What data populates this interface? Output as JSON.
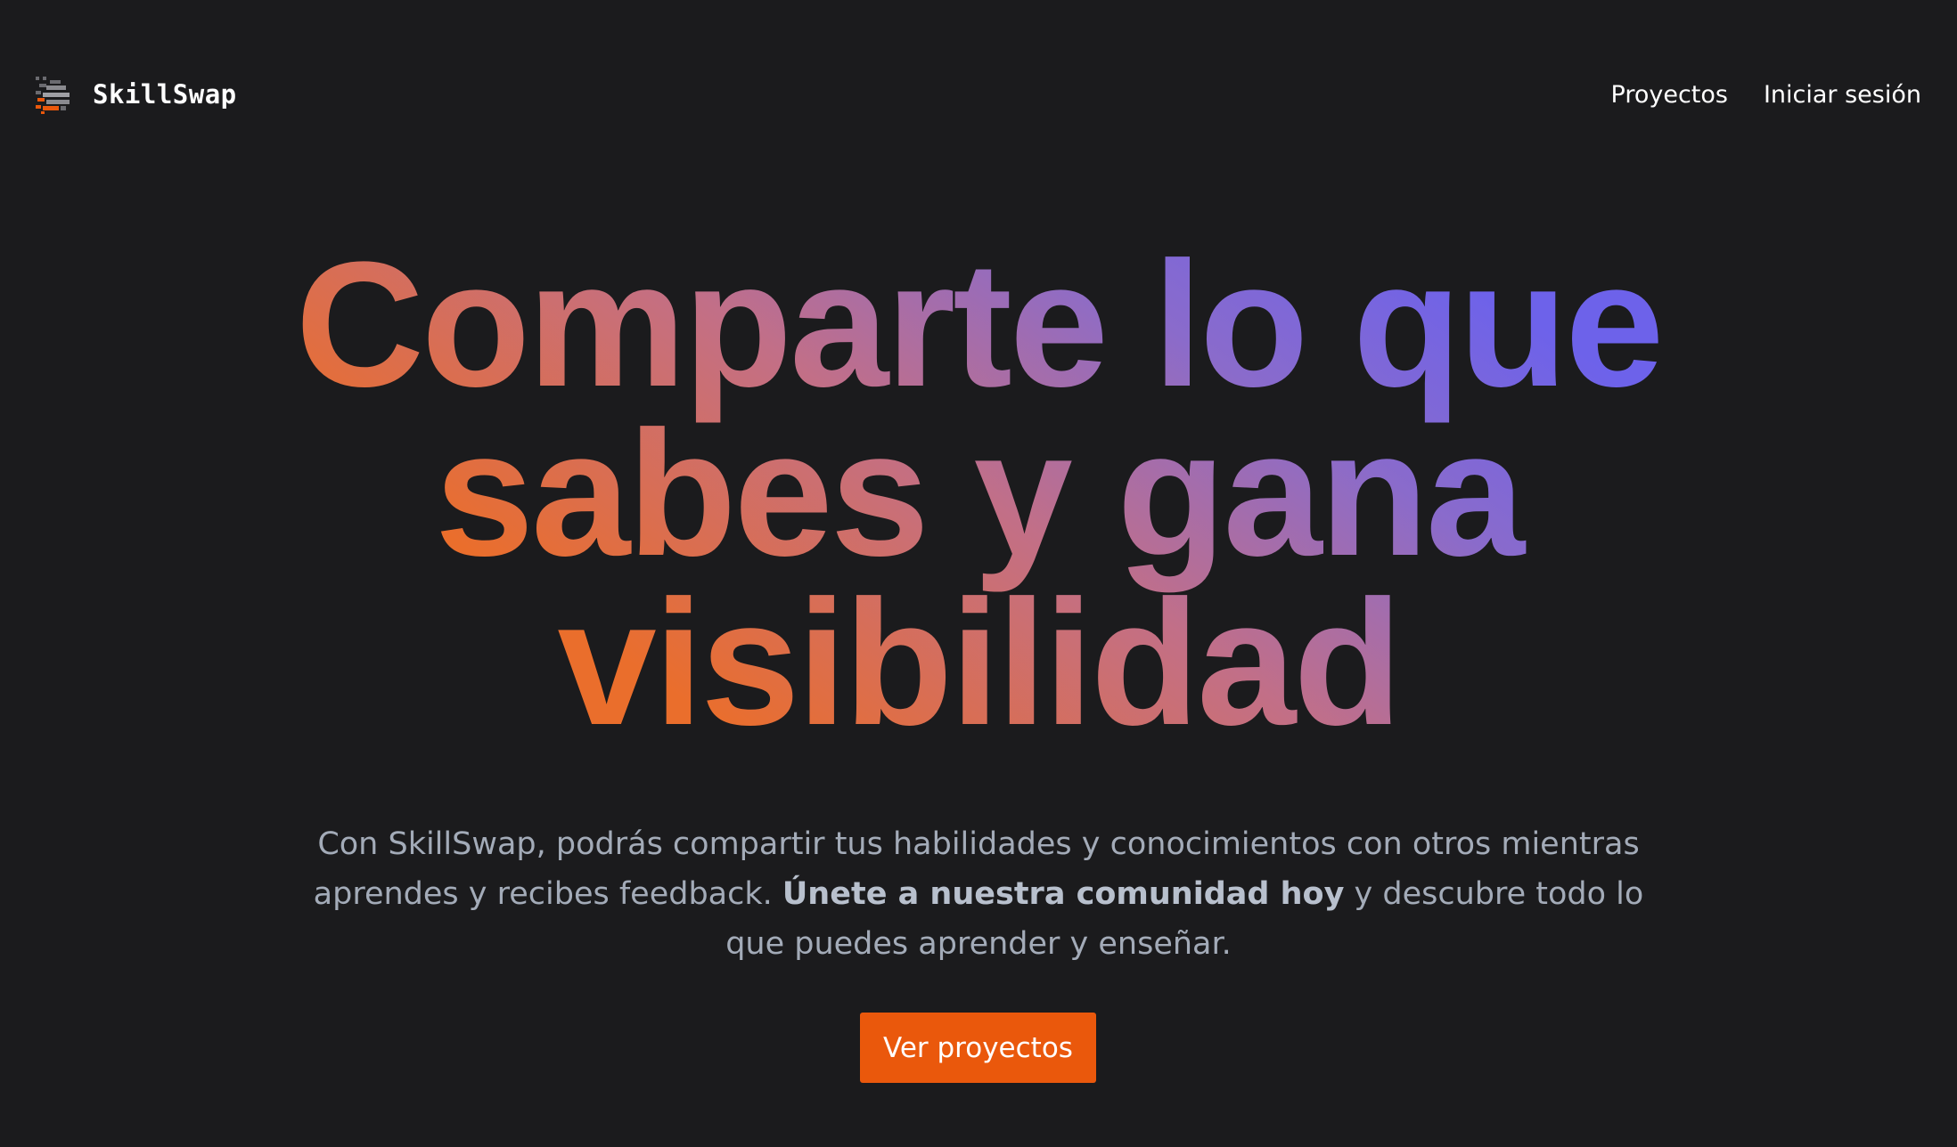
{
  "brand": {
    "name": "SkillSwap",
    "logo_icon": "skillswap-logo-icon",
    "logo_colors": [
      "#ea580c",
      "#6b6b70"
    ]
  },
  "nav": {
    "items": [
      {
        "label": "Proyectos"
      },
      {
        "label": "Iniciar sesión"
      }
    ]
  },
  "hero": {
    "title_lines": [
      "Comparte lo que",
      "sabes y gana",
      "visibilidad"
    ],
    "title_gradient": [
      "#ea6e2c",
      "#c26f87",
      "#8a6bcb",
      "#6d62ea"
    ],
    "subtitle_pre": "Con SkillSwap, podrás compartir tus habilidades y conocimientos con otros mientras aprendes y recibes feedback. ",
    "subtitle_bold": "Únete a nuestra comunidad hoy",
    "subtitle_post": " y descubre todo lo que puedes aprender y enseñar.",
    "cta_label": "Ver proyectos"
  },
  "colors": {
    "background": "#1b1b1d",
    "accent": "#ea580c",
    "text_primary": "#ffffff",
    "text_muted": "#a3abb8"
  }
}
